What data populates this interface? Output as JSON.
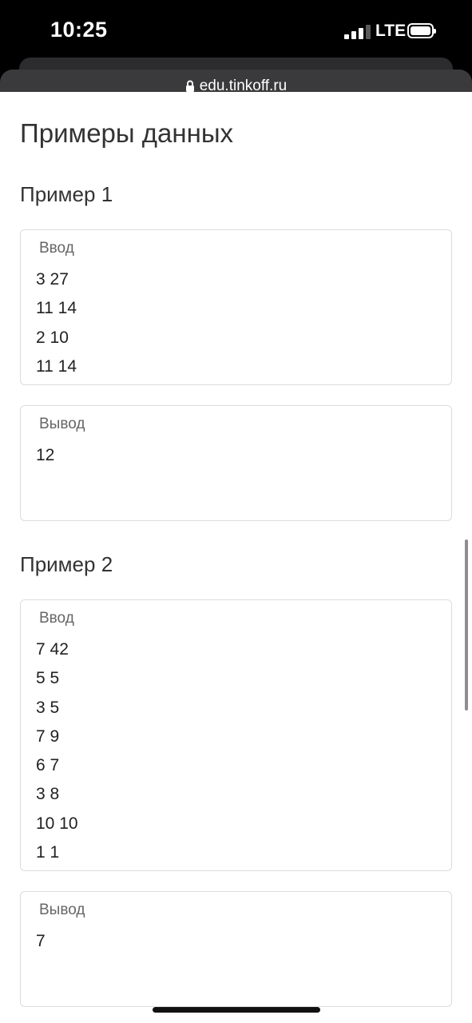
{
  "status_bar": {
    "time": "10:25",
    "network": "LTE",
    "signal_bars_active": 3,
    "signal_bars_total": 4,
    "battery_level": 1.0
  },
  "browser": {
    "url": "edu.tinkoff.ru",
    "lock_icon": "lock-icon"
  },
  "page": {
    "title": "Примеры данных",
    "examples": [
      {
        "title": "Пример 1",
        "input_label": "Ввод",
        "input_lines": [
          "3 27",
          "11 14",
          "2 10",
          "11 14"
        ],
        "output_label": "Вывод",
        "output_lines": [
          "12"
        ]
      },
      {
        "title": "Пример 2",
        "input_label": "Ввод",
        "input_lines": [
          "7 42",
          "5 5",
          "3 5",
          "7 9",
          "6 7",
          "3 8",
          "10 10",
          "1 1"
        ],
        "output_label": "Вывод",
        "output_lines": [
          "7"
        ]
      }
    ]
  },
  "colors": {
    "text": "#333333",
    "box_border": "#dcdcdc",
    "label": "#666666",
    "browser_chrome": "#3a3a3c"
  }
}
